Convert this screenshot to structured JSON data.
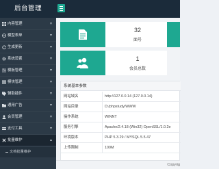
{
  "header": {
    "brand": "后台管理",
    "toggle_icon": "menu-icon"
  },
  "sidebar": {
    "items": [
      {
        "label": "内容管理",
        "icon": "grid-icon"
      },
      {
        "label": "模型表单",
        "icon": "globe-icon"
      },
      {
        "label": "生成更新",
        "icon": "refresh-icon"
      },
      {
        "label": "系统设置",
        "icon": "gear-icon"
      },
      {
        "label": "模板管理",
        "icon": "sliders-icon"
      },
      {
        "label": "模块管理",
        "icon": "list-icon"
      },
      {
        "label": "辅助插件",
        "icon": "tag-icon"
      },
      {
        "label": "通用广告",
        "icon": "folder-icon"
      },
      {
        "label": "会员管理",
        "icon": "users-icon"
      },
      {
        "label": "支付工具",
        "icon": "pay-icon"
      },
      {
        "label": "批量维护",
        "icon": "tools-icon"
      }
    ],
    "submenu_label": "文档批量维护"
  },
  "stats": [
    {
      "value": "32",
      "caption": "面号",
      "icon": "doc-icon",
      "color": "#1ea891"
    },
    {
      "value": "1",
      "caption": "会员总数",
      "icon": "users-icon",
      "color": "#1ea891"
    }
  ],
  "panel": {
    "title": "系统基本参数",
    "rows": [
      {
        "key": "网站域名",
        "value": "http://127.0.0.14 (127.0.0.14)"
      },
      {
        "key": "网站目录",
        "value": "D:/phpstudy/WWW"
      },
      {
        "key": "操作系统",
        "value": "WINNT"
      },
      {
        "key": "服务引擎",
        "value": "Apache/2.4.18 (Win32) OpenSSL/1.0.2e"
      },
      {
        "key": "环境版本",
        "value": "PHP 5.3.29 / MYSQL 5.5.47"
      },
      {
        "key": "上传限制",
        "value": "100M"
      }
    ]
  },
  "footer": {
    "copyright": "Copyrig"
  },
  "colors": {
    "accent": "#1ea891",
    "sidebar": "#2c3a47",
    "topbar": "#1b2b3a"
  }
}
